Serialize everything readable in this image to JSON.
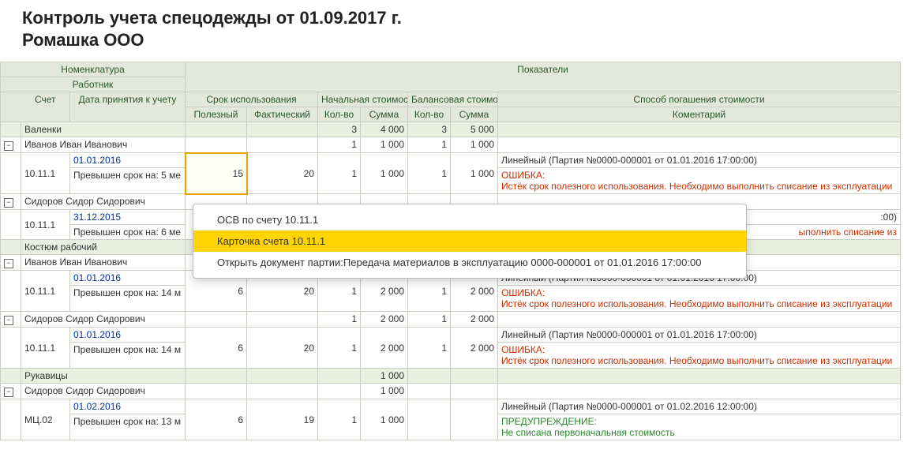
{
  "title1": "Контроль учета спецодежды от 01.09.2017 г.",
  "title2": "Ромашка ООО",
  "headers": {
    "nomen": "Номенклатура",
    "worker": "Работник",
    "indicators": "Показатели",
    "acct": "Счет",
    "accept_date": "Дата принятия к учету",
    "service": "Срок использования",
    "init_cost": "Начальная стоимость",
    "bal_cost": "Балансовая стоимость",
    "method": "Способ погашения стоимости",
    "useful": "Полезный",
    "actual": "Фактический",
    "qty": "Кол-во",
    "sum": "Сумма",
    "comment": "Коментарий"
  },
  "items": [
    {
      "name": "Валенки",
      "k1": "3",
      "s1": "4 000",
      "k2": "3",
      "s2": "5 000",
      "workers": [
        {
          "name": "Иванов Иван Иванович",
          "k1": "1",
          "s1": "1 000",
          "k2": "1",
          "s2": "1 000",
          "acct": "10.11.1",
          "date": "01.01.2016",
          "overdue": "Превышен срок на: 5 ме",
          "useful": "15",
          "actual": "20",
          "method": "Линейный (Партия №0000-000001 от 01.01.2016 17:00:00)",
          "err_title": "ОШИБКА:",
          "err_body": "Истёк срок полезного использования. Необходимо выполнить списание из эксплуатации"
        },
        {
          "name": "Сидоров Сидор Сидорович",
          "k1": "",
          "s1": "",
          "k2": "",
          "s2": "",
          "acct": "10.11.1",
          "date": "31.12.2015",
          "overdue": "Превышен срок на: 6 ме",
          "useful": "",
          "actual": "",
          "method_tail": ":00)",
          "err_title": "",
          "err_body_tail": "ыполнить списание из"
        }
      ]
    },
    {
      "name": "Костюм рабочий",
      "k1": "",
      "s1": "",
      "k2": "",
      "s2": "",
      "workers": [
        {
          "name": "Иванов Иван Иванович",
          "k1": "1",
          "s1": "2 000",
          "k2": "1",
          "s2": "2 000",
          "acct": "10.11.1",
          "date": "01.01.2016",
          "overdue": "Превышен срок на: 14 м",
          "useful": "6",
          "actual": "20",
          "dk1": "1",
          "ds1": "2 000",
          "dk2": "1",
          "ds2": "2 000",
          "method": "Линейный (Партия №0000-000001 от 01.01.2016 17:00:00)",
          "err_title": "ОШИБКА:",
          "err_body": "Истёк срок полезного использования. Необходимо выполнить списание из эксплуатации"
        },
        {
          "name": "Сидоров Сидор Сидорович",
          "k1": "1",
          "s1": "2 000",
          "k2": "1",
          "s2": "2 000",
          "acct": "10.11.1",
          "date": "01.01.2016",
          "overdue": "Превышен срок на: 14 м",
          "useful": "6",
          "actual": "20",
          "dk1": "1",
          "ds1": "2 000",
          "dk2": "1",
          "ds2": "2 000",
          "method": "Линейный (Партия №0000-000001 от 01.01.2016 17:00:00)",
          "err_title": "ОШИБКА:",
          "err_body": "Истёк срок полезного использования. Необходимо выполнить списание из эксплуатации"
        }
      ]
    },
    {
      "name": "Рукавицы",
      "s1": "1 000",
      "workers": [
        {
          "name": "Сидоров Сидор Сидорович",
          "s1": "1 000",
          "acct": "МЦ.02",
          "date": "01.02.2016",
          "overdue": "Превышен срок на: 13 м",
          "useful": "6",
          "actual": "19",
          "dk1": "1",
          "ds1": "1 000",
          "dk2": "",
          "ds2": "",
          "method": "Линейный (Партия №0000-000001 от 01.02.2016 12:00:00)",
          "warn_title": "ПРЕДУПРЕЖДЕНИЕ:",
          "warn_body": "Не списана первоначальная стоимость"
        }
      ]
    }
  ],
  "menu": {
    "m1": "ОСВ по счету 10.11.1",
    "m2": "Карточка счета 10.11.1",
    "m3": "Открыть документ партии:Передача материалов в эксплуатацию 0000-000001 от 01.01.2016 17:00:00"
  }
}
